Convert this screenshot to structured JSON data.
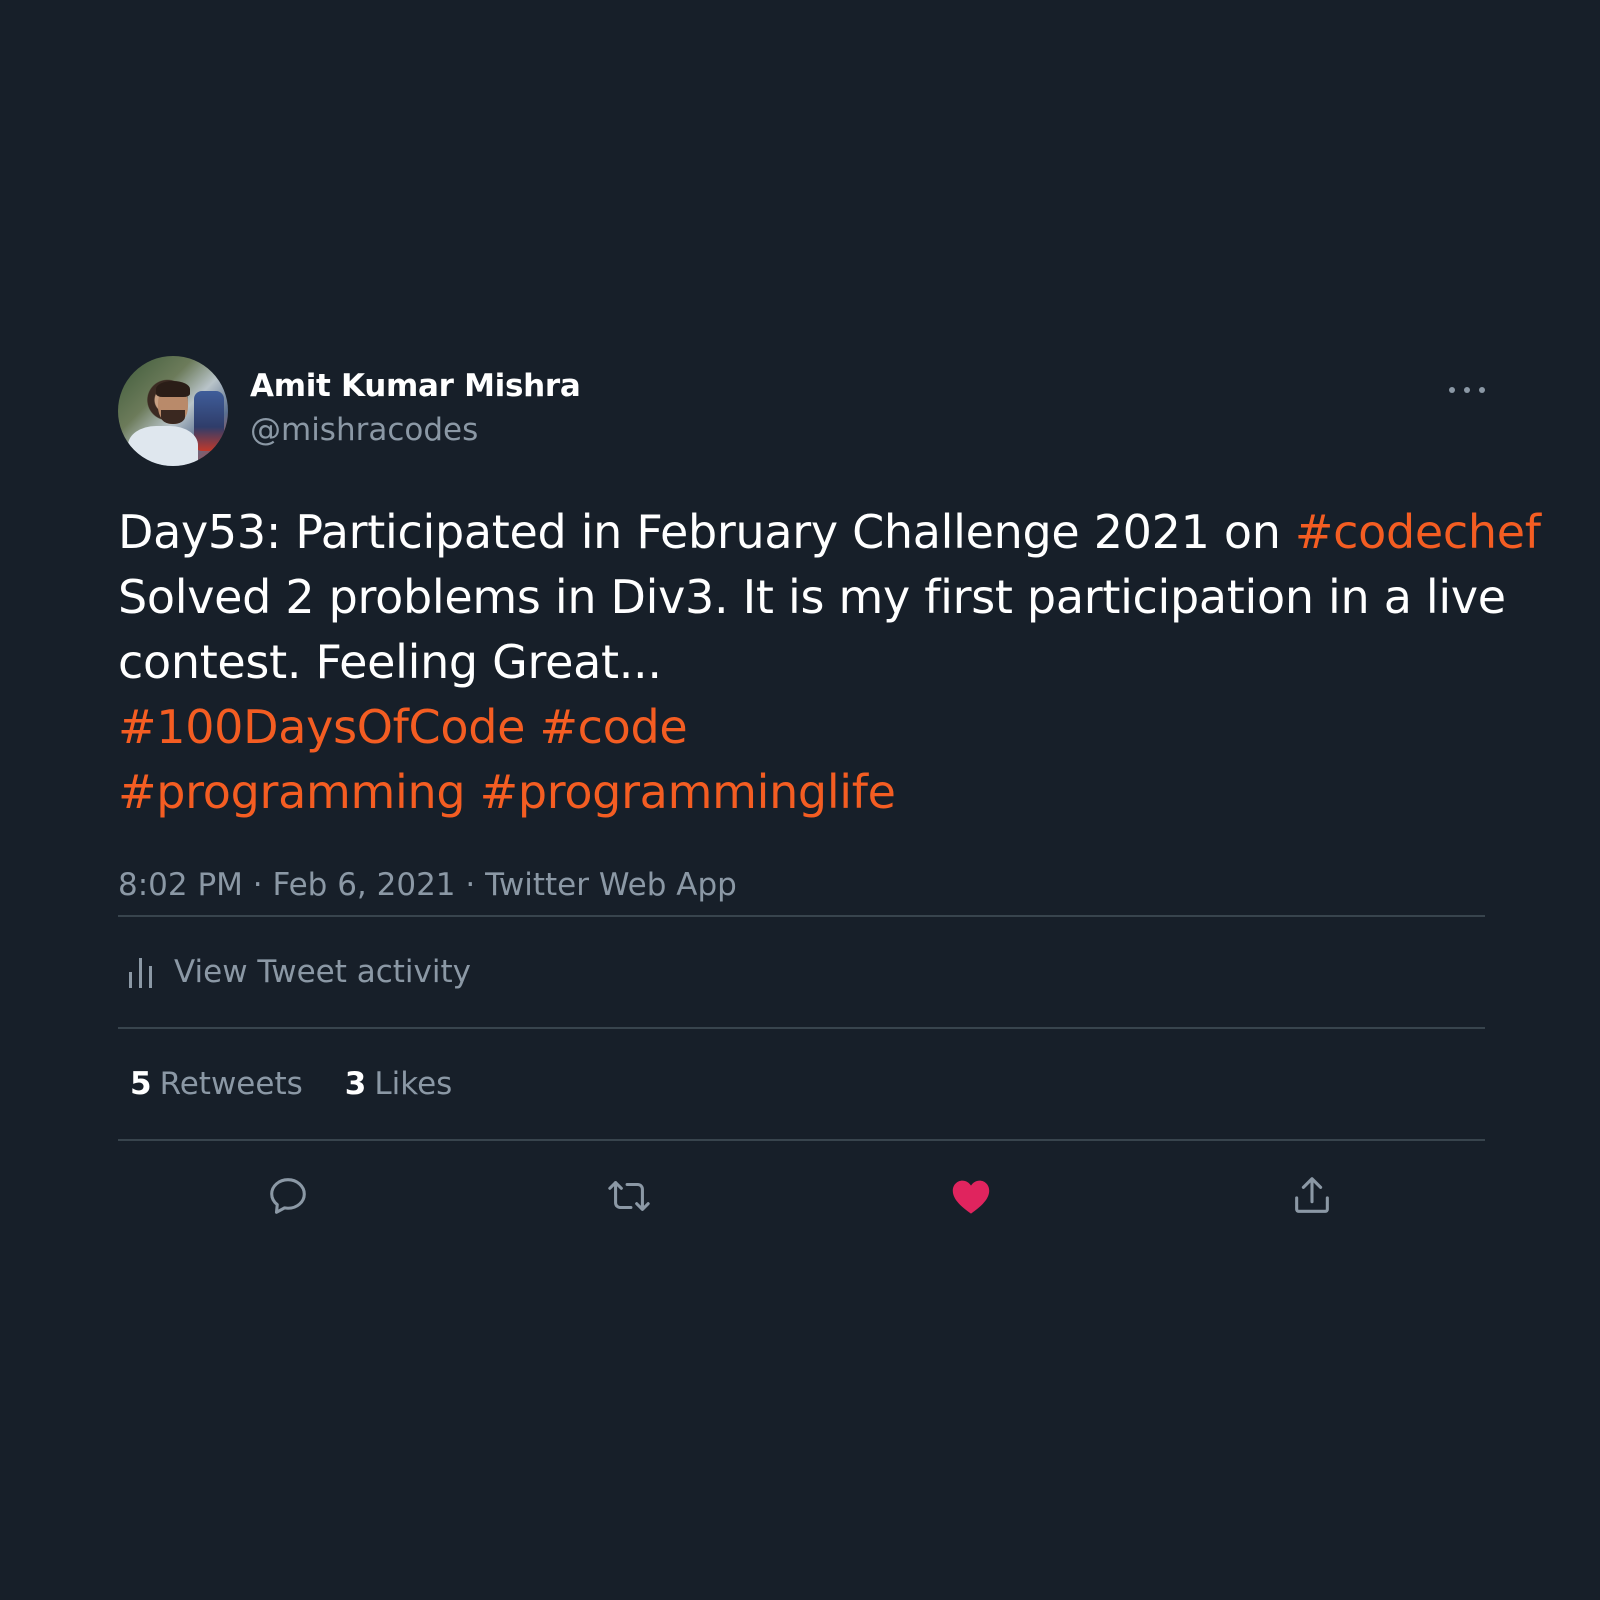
{
  "tweet": {
    "author_name": "Amit Kumar Mishra",
    "author_handle": "@mishracodes",
    "more_icon": "ellipsis-icon",
    "text_lines": [
      [
        {
          "text": "Day53: Participated in February Challenge 2021 on ",
          "hashtag": false
        },
        {
          "text": "#codechef",
          "hashtag": true
        }
      ],
      [
        {
          "text": "Solved 2 problems in Div3. It is my first participation in a live",
          "hashtag": false
        }
      ],
      [
        {
          "text": "contest. Feeling Great...",
          "hashtag": false
        }
      ],
      [
        {
          "text": "#100DaysOfCode",
          "hashtag": true
        },
        {
          "text": " ",
          "hashtag": false
        },
        {
          "text": "#code",
          "hashtag": true
        }
      ],
      [
        {
          "text": "#programming",
          "hashtag": true
        },
        {
          "text": " ",
          "hashtag": false
        },
        {
          "text": "#programminglife",
          "hashtag": true
        }
      ]
    ],
    "meta": "8:02 PM · Feb 6, 2021 · Twitter Web App",
    "activity_label": "View Tweet activity",
    "retweets_count": "5",
    "retweets_label": "Retweets",
    "likes_count": "3",
    "likes_label": "Likes",
    "liked": true
  },
  "actions": [
    {
      "name": "reply-icon"
    },
    {
      "name": "retweet-icon"
    },
    {
      "name": "like-icon"
    },
    {
      "name": "share-icon"
    }
  ],
  "colors": {
    "background": "#171f29",
    "hashtag": "#f45d22",
    "muted": "#8b98a5",
    "divider": "#38444d",
    "like_active": "#e0245e"
  }
}
